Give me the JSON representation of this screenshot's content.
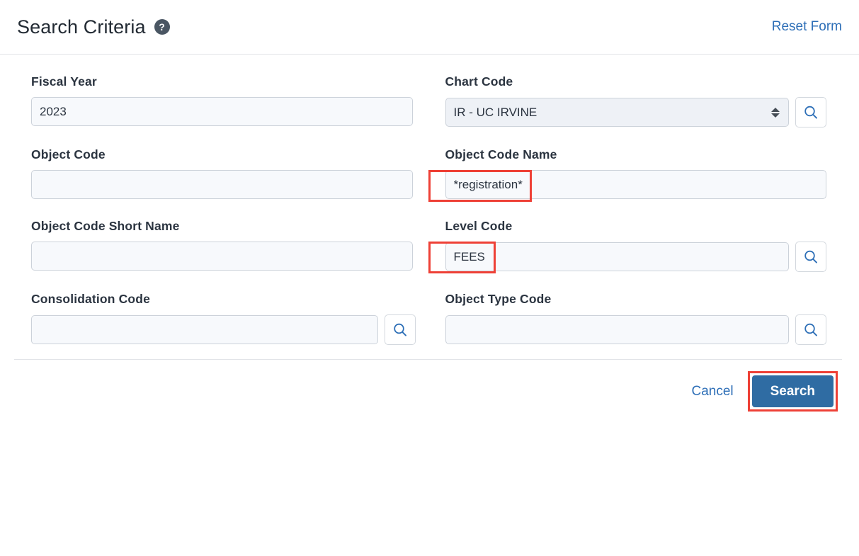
{
  "header": {
    "title": "Search Criteria",
    "help_icon": "question-mark-circle-icon",
    "reset_label": "Reset Form"
  },
  "fields": {
    "fiscal_year": {
      "label": "Fiscal Year",
      "value": "2023",
      "placeholder": ""
    },
    "chart_code": {
      "label": "Chart Code",
      "value": "IR - UC IRVINE",
      "options": [
        "IR - UC IRVINE"
      ]
    },
    "object_code": {
      "label": "Object Code",
      "value": "",
      "placeholder": ""
    },
    "object_code_name": {
      "label": "Object Code Name",
      "value": "*registration*",
      "placeholder": ""
    },
    "object_code_short_name": {
      "label": "Object Code Short Name",
      "value": "",
      "placeholder": ""
    },
    "level_code": {
      "label": "Level Code",
      "value": "FEES",
      "placeholder": ""
    },
    "consolidation_code": {
      "label": "Consolidation Code",
      "value": "",
      "placeholder": ""
    },
    "object_type_code": {
      "label": "Object Type Code",
      "value": "",
      "placeholder": ""
    }
  },
  "footer": {
    "cancel_label": "Cancel",
    "search_label": "Search"
  },
  "icons": {
    "lookup": "magnifier-search-icon"
  },
  "colors": {
    "link_blue": "#2e6fb7",
    "button_blue": "#2f6ca3",
    "annotation_red": "#ee4036",
    "help_badge": "#4a5663",
    "input_fill": "#f7f9fc"
  }
}
